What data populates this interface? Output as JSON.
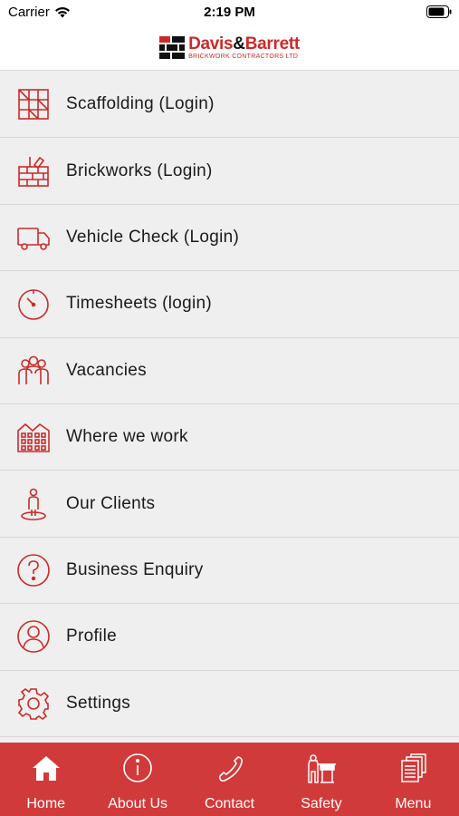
{
  "status": {
    "carrier": "Carrier",
    "time": "2:19 PM"
  },
  "header": {
    "logo_part1": "Davis",
    "logo_amp": "&",
    "logo_part2": "Barrett",
    "logo_subtitle": "BRICKWORK CONTRACTORS LTD"
  },
  "menu": {
    "items": [
      {
        "label": "Scaffolding (Login)",
        "icon": "scaffolding-icon"
      },
      {
        "label": "Brickworks (Login)",
        "icon": "brickwork-icon"
      },
      {
        "label": "Vehicle Check (Login)",
        "icon": "truck-icon"
      },
      {
        "label": "Timesheets (login)",
        "icon": "stopwatch-icon"
      },
      {
        "label": "Vacancies",
        "icon": "people-icon"
      },
      {
        "label": "Where we work",
        "icon": "buildings-icon"
      },
      {
        "label": "Our Clients",
        "icon": "person-pin-icon"
      },
      {
        "label": "Business Enquiry",
        "icon": "question-icon"
      },
      {
        "label": "Profile",
        "icon": "user-circle-icon"
      },
      {
        "label": "Settings",
        "icon": "gear-icon"
      }
    ]
  },
  "tabs": [
    {
      "label": "Home",
      "icon": "home-icon"
    },
    {
      "label": "About Us",
      "icon": "info-icon"
    },
    {
      "label": "Contact",
      "icon": "phone-icon"
    },
    {
      "label": "Safety",
      "icon": "safety-worker-icon"
    },
    {
      "label": "Menu",
      "icon": "documents-icon"
    }
  ],
  "colors": {
    "accent": "#d13a3a",
    "icon_red": "#cc2a2a",
    "list_bg": "#efefef"
  }
}
